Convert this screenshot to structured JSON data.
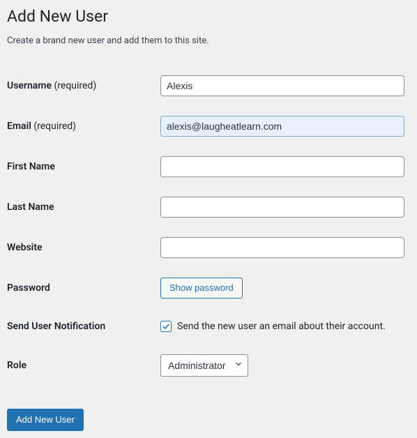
{
  "page_title": "Add New User",
  "description": "Create a brand new user and add them to this site.",
  "required_text": "(required)",
  "fields": {
    "username": {
      "label": "Username",
      "value": "Alexis"
    },
    "email": {
      "label": "Email",
      "value": "alexis@laugheatlearn.com"
    },
    "first_name": {
      "label": "First Name",
      "value": ""
    },
    "last_name": {
      "label": "Last Name",
      "value": ""
    },
    "website": {
      "label": "Website",
      "value": ""
    },
    "password": {
      "label": "Password",
      "show_button": "Show password"
    },
    "notification": {
      "label": "Send User Notification",
      "checkbox_label": "Send the new user an email about their account.",
      "checked": true
    },
    "role": {
      "label": "Role",
      "selected": "Administrator"
    }
  },
  "submit_button": "Add New User"
}
